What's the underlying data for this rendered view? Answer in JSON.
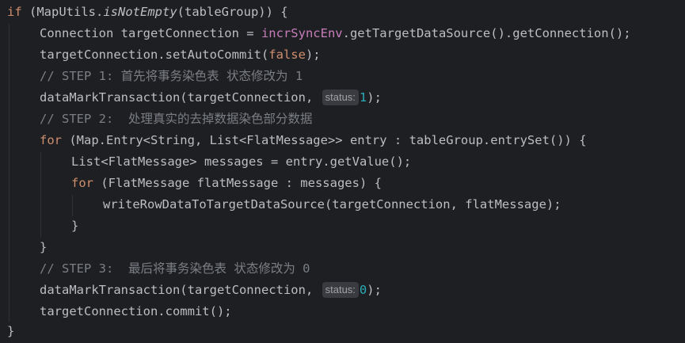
{
  "code": {
    "l1": {
      "kw": "if",
      "a": " (MapUtils.",
      "method": "isNotEmpty",
      "b": "(tableGroup)) {"
    },
    "l2": {
      "a": "Connection targetConnection = ",
      "field": "incrSyncEnv",
      "b": ".getTargetDataSource().getConnection();"
    },
    "l3": {
      "a": "targetConnection.setAutoCommit(",
      "kw": "false",
      "b": ");"
    },
    "l4": {
      "comment": "// STEP 1: 首先将事务染色表 状态修改为 1"
    },
    "l5": {
      "a": "dataMarkTransaction(targetConnection, ",
      "hint": "status:",
      "num": "1",
      "b": ");"
    },
    "l6": {
      "comment": "// STEP 2:  处理真实的去掉数据染色部分数据"
    },
    "l7": {
      "kw": "for",
      "a": " (Map.Entry<String, List<FlatMessage>> entry : tableGroup.entrySet()) {"
    },
    "l8": {
      "a": "List<FlatMessage> messages = entry.getValue();"
    },
    "l9": {
      "kw": "for",
      "a": " (FlatMessage flatMessage : messages) {"
    },
    "l10": {
      "a": "writeRowDataToTargetDataSource(targetConnection, flatMessage);"
    },
    "l11": {
      "a": "}"
    },
    "l12": {
      "a": "}"
    },
    "l13": {
      "comment": "// STEP 3:  最后将事务染色表 状态修改为 0"
    },
    "l14": {
      "a": "dataMarkTransaction(targetConnection, ",
      "hint": "status:",
      "num": "0",
      "b": ");"
    },
    "l15": {
      "a": "targetConnection.commit();"
    },
    "l16": {
      "a": "}"
    }
  },
  "colors": {
    "background": "#1e1f22",
    "text": "#bcbec4",
    "keyword": "#cf8e6d",
    "field": "#c77dbb",
    "number": "#2aacb8",
    "comment": "#7a7e85",
    "hint_background": "#393b40"
  }
}
